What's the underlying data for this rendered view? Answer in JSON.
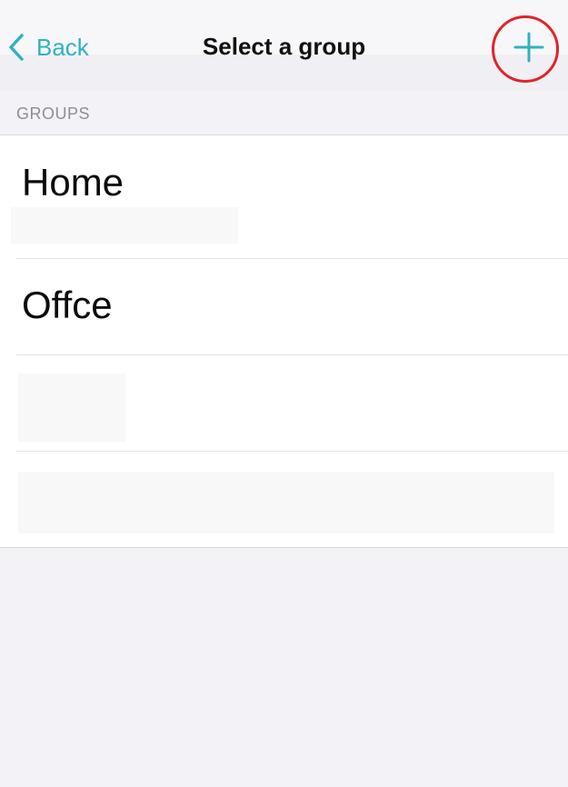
{
  "nav": {
    "back_label": "Back",
    "title": "Select a group",
    "add_icon": "plus-icon",
    "back_icon": "chevron-left-icon"
  },
  "section": {
    "header": "GROUPS"
  },
  "groups": [
    {
      "name": "Home"
    },
    {
      "name": "Offce"
    },
    {
      "name": ""
    },
    {
      "name": ""
    }
  ],
  "colors": {
    "accent": "#2fb2c4",
    "annotation": "#e3222a",
    "background": "#f2f2f7"
  }
}
